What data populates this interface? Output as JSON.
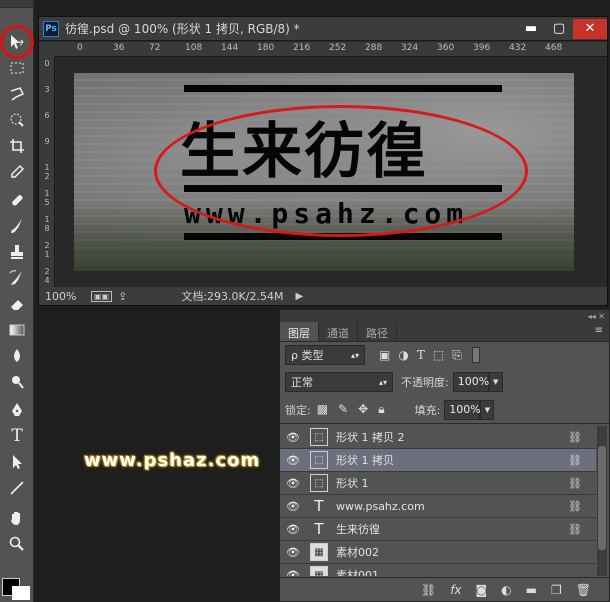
{
  "document": {
    "title": "彷徨.psd @ 100% (形状 1 拷贝, RGB/8) *",
    "minimize": "▬",
    "maximize": "▢",
    "close": "✕",
    "ruler_h": [
      "0",
      "36",
      "72",
      "108",
      "144",
      "180",
      "216",
      "252",
      "288",
      "324",
      "360",
      "396",
      "432",
      "468"
    ],
    "ruler_v": [
      "0",
      "3",
      "6",
      "9",
      "1\n2",
      "1\n5",
      "1\n8",
      "2\n1",
      "2\n4"
    ],
    "canvas_headline": "生来彷徨",
    "canvas_url": "www.psahz.com",
    "status_zoom": "100%",
    "status_info": "文档:293.0K/2.54M",
    "status_arrow": "▶"
  },
  "watermark": "www.pshaz.com",
  "layers_panel": {
    "tabs": [
      "图层",
      "通道",
      "路径"
    ],
    "menu": "≡",
    "collapse": "◂◂ ✕",
    "filter_label": "ρ 类型",
    "blend_mode": "正常",
    "opacity_label": "不透明度:",
    "opacity_value": "100%",
    "lock_label": "锁定:",
    "fill_label": "填充:",
    "fill_value": "100%",
    "layers": [
      {
        "name": "形状 1 拷贝 2",
        "kind": "shape",
        "linked": true,
        "selected": false
      },
      {
        "name": "形状 1 拷贝",
        "kind": "shape",
        "linked": true,
        "selected": true
      },
      {
        "name": "形状 1",
        "kind": "shape",
        "linked": true,
        "selected": false
      },
      {
        "name": "www.psahz.com",
        "kind": "text",
        "linked": true,
        "selected": false
      },
      {
        "name": "生来彷徨",
        "kind": "text",
        "linked": true,
        "selected": false
      },
      {
        "name": "素材002",
        "kind": "image",
        "linked": false,
        "selected": false
      },
      {
        "name": "素材001",
        "kind": "image",
        "linked": false,
        "selected": false
      }
    ]
  },
  "colors": {
    "highlight": "#e01010",
    "selected_layer": "#6b6f7e"
  }
}
